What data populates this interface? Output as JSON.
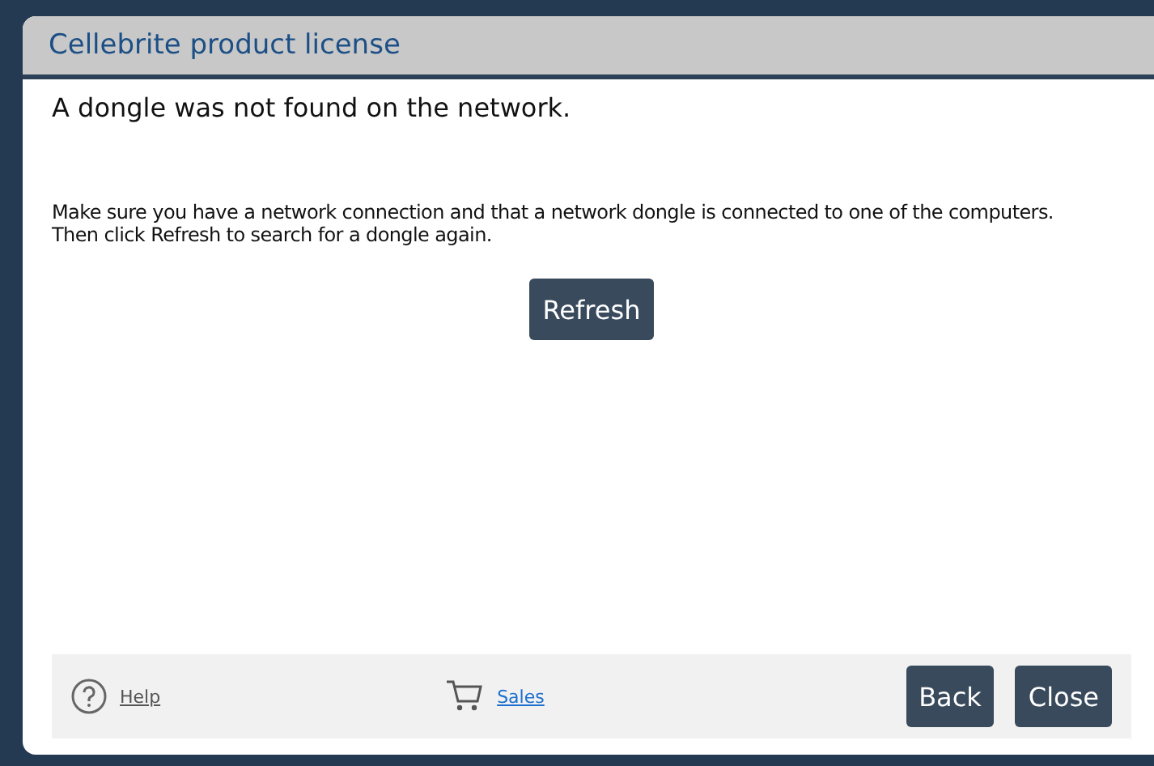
{
  "window": {
    "title": "Cellebrite product license"
  },
  "heading": "A dongle was not found on the network.",
  "message": [
    "Make sure you have a network connection and that a network dongle is connected to one of the computers.",
    "Then click Refresh to search for a dongle again."
  ],
  "refresh_button": "Refresh",
  "footer": {
    "help_link": "Help",
    "sales_link": "Sales",
    "buttons": [
      "Back",
      "Close"
    ]
  }
}
